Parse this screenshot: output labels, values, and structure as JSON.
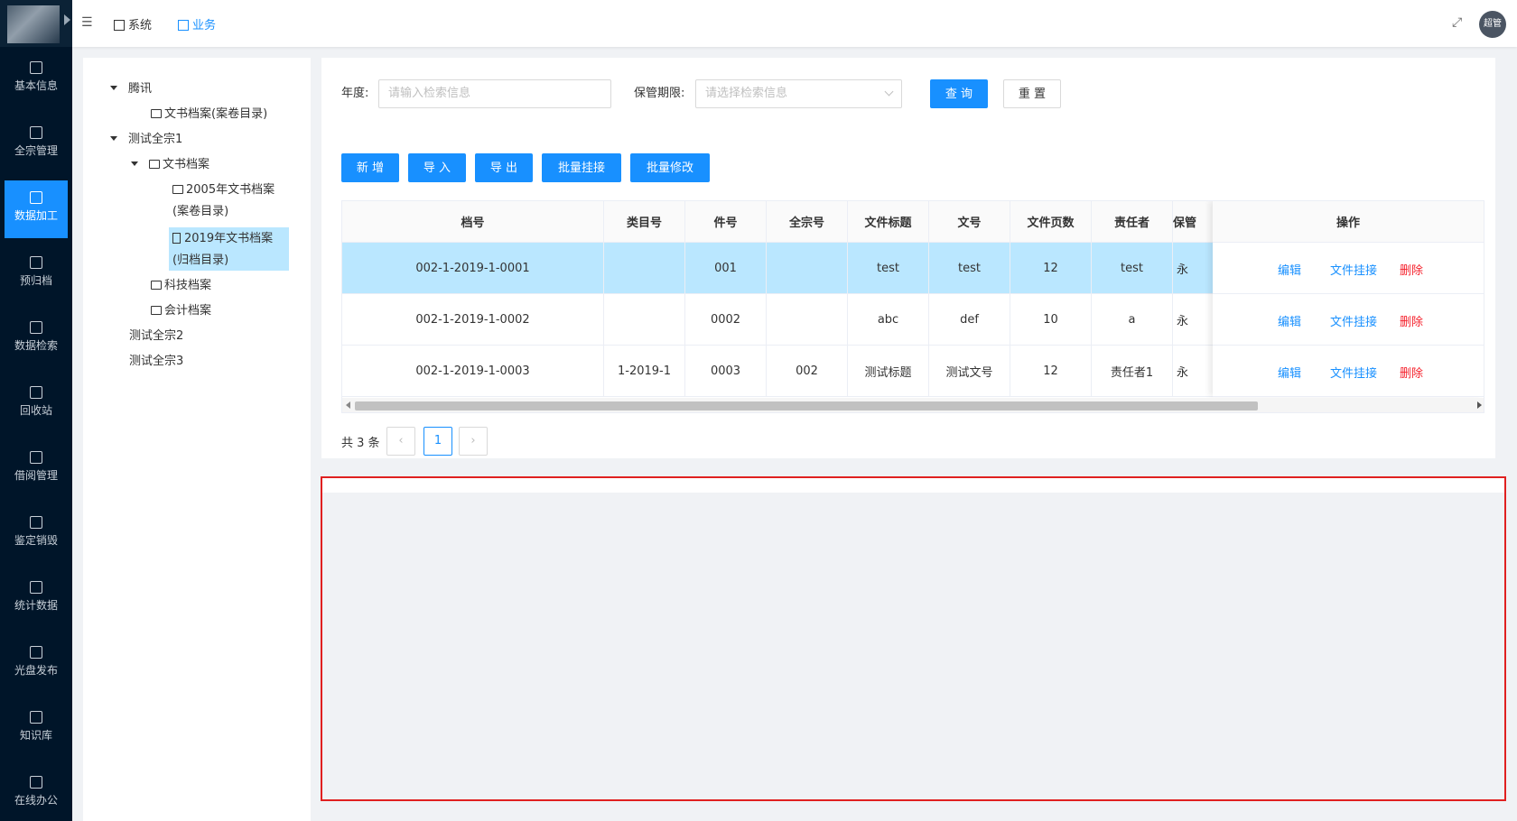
{
  "sidebar": {
    "items": [
      {
        "label": "基本信息",
        "icon": "document-icon"
      },
      {
        "label": "全宗管理",
        "icon": "grid-icon"
      },
      {
        "label": "数据加工",
        "icon": "grid-icon",
        "active": true
      },
      {
        "label": "预归档",
        "icon": "refresh-icon"
      },
      {
        "label": "数据检索",
        "icon": "search-icon"
      },
      {
        "label": "回收站",
        "icon": "trash-icon"
      },
      {
        "label": "借阅管理",
        "icon": "save-icon"
      },
      {
        "label": "鉴定销毁",
        "icon": "grid-icon"
      },
      {
        "label": "统计数据",
        "icon": "table-icon"
      },
      {
        "label": "光盘发布",
        "icon": "disc-icon"
      },
      {
        "label": "知识库",
        "icon": "grid-icon"
      },
      {
        "label": "在线办公",
        "icon": "monitor-icon"
      }
    ]
  },
  "topbar": {
    "nav": [
      {
        "label": "系统",
        "icon": "grid-icon"
      },
      {
        "label": "业务",
        "icon": "list-icon",
        "active": true
      }
    ],
    "avatar_text": "超管"
  },
  "tree": {
    "nodes": [
      {
        "label": "腾讯",
        "level": 0,
        "expanded": true
      },
      {
        "label": "文书档案(案卷目录)",
        "level": 2,
        "icon": "folder-icon"
      },
      {
        "label": "测试全宗1",
        "level": 0,
        "expanded": true
      },
      {
        "label": "文书档案",
        "level": 1,
        "expanded": true,
        "icon": "folder-open-icon"
      },
      {
        "label": "2005年文书档案",
        "label2": "(案卷目录)",
        "level": 2,
        "icon": "folder-icon"
      },
      {
        "label": "2019年文书档案",
        "label2": "(归档目录)",
        "level": 2,
        "icon": "file-icon",
        "selected": true
      },
      {
        "label": "科技档案",
        "level": 1,
        "icon": "folder-open-icon"
      },
      {
        "label": "会计档案",
        "level": 1,
        "icon": "folder-open-icon"
      },
      {
        "label": "测试全宗2",
        "level": 0
      },
      {
        "label": "测试全宗3",
        "level": 0
      }
    ]
  },
  "search": {
    "year_label": "年度:",
    "year_placeholder": "请输入检索信息",
    "term_label": "保管期限:",
    "term_placeholder": "请选择检索信息",
    "query_btn": "查 询",
    "reset_btn": "重 置"
  },
  "actions": {
    "add": "新 增",
    "import": "导 入",
    "export": "导 出",
    "batch_link": "批量挂接",
    "batch_edit": "批量修改"
  },
  "table": {
    "headers": [
      "档号",
      "类目号",
      "件号",
      "全宗号",
      "文件标题",
      "文号",
      "文件页数",
      "责任者",
      "保管"
    ],
    "op_header": "操作",
    "rows": [
      {
        "cells": [
          "002-1-2019-1-0001",
          "",
          "001",
          "",
          "test",
          "test",
          "12",
          "test",
          "永"
        ],
        "highlight": true
      },
      {
        "cells": [
          "002-1-2019-1-0002",
          "",
          "0002",
          "",
          "abc",
          "def",
          "10",
          "a",
          "永"
        ]
      },
      {
        "cells": [
          "002-1-2019-1-0003",
          "1-2019-1",
          "0003",
          "002",
          "测试标题",
          "测试文号",
          "12",
          "责任者1",
          "永"
        ]
      }
    ],
    "ops": {
      "edit": "编辑",
      "link": "文件挂接",
      "delete": "删除"
    }
  },
  "pagination": {
    "total": "共 3 条",
    "prev": "‹",
    "page": "1",
    "next": "›"
  }
}
